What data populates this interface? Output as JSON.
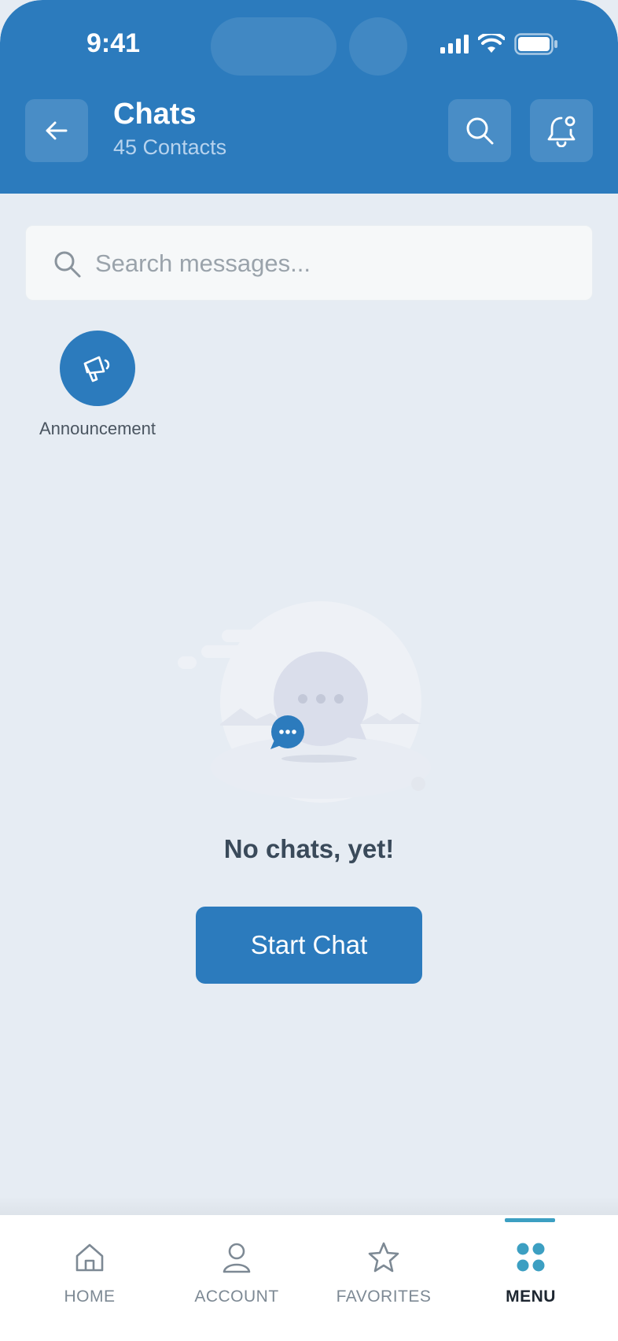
{
  "status_bar": {
    "time": "9:41"
  },
  "header": {
    "title": "Chats",
    "subtitle": "45 Contacts",
    "back_icon": "arrow-left-icon",
    "search_icon": "search-icon",
    "notification_icon": "bell-notification-icon"
  },
  "search": {
    "placeholder": "Search messages..."
  },
  "announcement": {
    "label": "Announcement",
    "icon": "megaphone-icon"
  },
  "empty_state": {
    "title": "No chats, yet!",
    "button_label": "Start Chat"
  },
  "bottom_nav": {
    "items": [
      {
        "label": "HOME",
        "icon": "home-icon",
        "active": false
      },
      {
        "label": "ACCOUNT",
        "icon": "user-icon",
        "active": false
      },
      {
        "label": "FAVORITES",
        "icon": "star-icon",
        "active": false
      },
      {
        "label": "MENU",
        "icon": "menu-grid-icon",
        "active": true
      }
    ]
  },
  "colors": {
    "primary": "#2c7bbd",
    "background": "#e6ecf3",
    "active_indicator": "#3c9fc2"
  }
}
